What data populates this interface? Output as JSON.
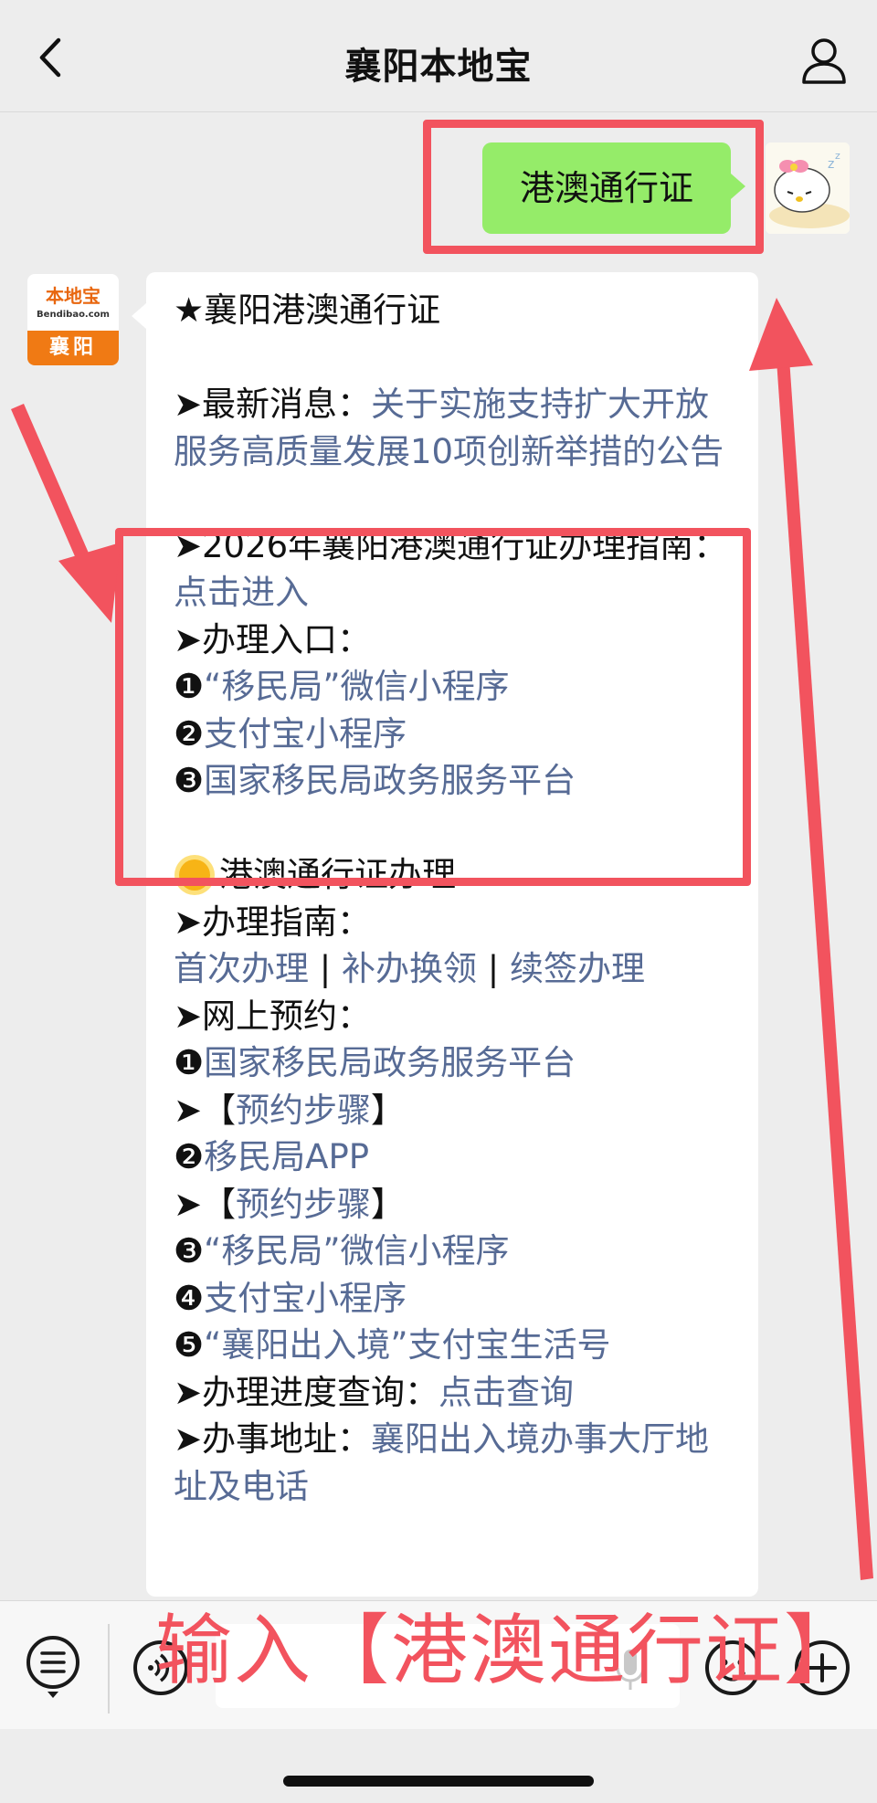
{
  "nav": {
    "title": "襄阳本地宝"
  },
  "me": {
    "message": "港澳通行证"
  },
  "bot": {
    "avatar_logo": "本地宝",
    "avatar_domain": "Bendibao.com",
    "avatar_city": "襄阳",
    "lines": [
      {
        "parts": [
          {
            "t": "★襄阳港澳通行证"
          }
        ]
      },
      {
        "parts": []
      },
      {
        "parts": [
          {
            "t": "➤最新消息："
          },
          {
            "t": "关于实施支持扩大开放服务高质量发展10项创新举措的公告",
            "link": true
          }
        ]
      },
      {
        "parts": []
      },
      {
        "parts": [
          {
            "t": "➤2026年襄阳港澳通行证办理指南："
          },
          {
            "t": "点击进入",
            "link": true
          }
        ]
      },
      {
        "parts": [
          {
            "t": "➤办理入口："
          }
        ]
      },
      {
        "parts": [
          {
            "t": "❶"
          },
          {
            "t": "“移民局”微信小程序",
            "link": true
          }
        ]
      },
      {
        "parts": [
          {
            "t": "❷"
          },
          {
            "t": "支付宝小程序",
            "link": true
          }
        ]
      },
      {
        "parts": [
          {
            "t": "❸"
          },
          {
            "t": "国家移民局政务服务平台",
            "link": true
          }
        ]
      },
      {
        "parts": []
      },
      {
        "sun": true,
        "parts": [
          {
            "t": "港澳通行证办理"
          }
        ]
      },
      {
        "parts": [
          {
            "t": "➤办理指南："
          }
        ]
      },
      {
        "parts": [
          {
            "t": "首次办理",
            "link": true
          },
          {
            "t": " | "
          },
          {
            "t": "补办换领",
            "link": true
          },
          {
            "t": " | "
          },
          {
            "t": "续签办理",
            "link": true
          }
        ]
      },
      {
        "parts": [
          {
            "t": "➤网上预约："
          }
        ]
      },
      {
        "parts": [
          {
            "t": "❶"
          },
          {
            "t": "国家移民局政务服务平台",
            "link": true
          }
        ]
      },
      {
        "parts": [
          {
            "t": "➤【"
          },
          {
            "t": "预约步骤",
            "link": true
          },
          {
            "t": "】"
          }
        ]
      },
      {
        "parts": [
          {
            "t": "❷"
          },
          {
            "t": "移民局APP",
            "link": true
          }
        ]
      },
      {
        "parts": [
          {
            "t": "➤【"
          },
          {
            "t": "预约步骤",
            "link": true
          },
          {
            "t": "】"
          }
        ]
      },
      {
        "parts": [
          {
            "t": "❸"
          },
          {
            "t": "“移民局”微信小程序",
            "link": true
          }
        ]
      },
      {
        "parts": [
          {
            "t": "❹"
          },
          {
            "t": "支付宝小程序",
            "link": true
          }
        ]
      },
      {
        "parts": [
          {
            "t": "❺"
          },
          {
            "t": "“襄阳出入境”支付宝生活号",
            "link": true
          }
        ]
      },
      {
        "parts": [
          {
            "t": "➤办理进度查询："
          },
          {
            "t": "点击查询",
            "link": true
          }
        ]
      },
      {
        "parts": [
          {
            "t": "➤办事地址："
          },
          {
            "t": "襄阳出入境办事大厅地址及电话",
            "link": true
          }
        ]
      }
    ]
  },
  "overlay": {
    "text": "输入【港澳通行证】"
  },
  "icons": {
    "back": "chevron-left-icon",
    "profile": "person-icon",
    "menu": "list-menu-icon",
    "voice": "voice-icon",
    "mic": "microphone-icon",
    "emoji": "emoji-icon",
    "plus": "plus-icon"
  },
  "colors": {
    "accent_red": "#f2535e",
    "link_blue": "#576b95",
    "my_bubble": "#95ec69",
    "brand_orange": "#f07a14"
  }
}
